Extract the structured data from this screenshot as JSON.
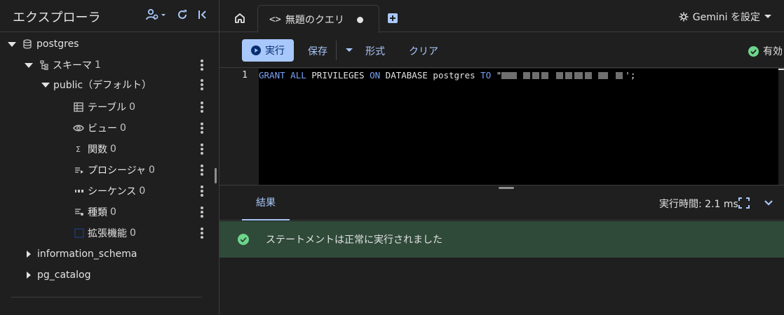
{
  "sidebar": {
    "title": "エクスプローラ",
    "tree": {
      "db": {
        "label": "postgres"
      },
      "schema_group": {
        "label": "スキーマ",
        "count": "1"
      },
      "public": {
        "label": "public（デフォルト）"
      },
      "items": [
        {
          "label": "テーブル",
          "count": "0",
          "icon": "table-icon"
        },
        {
          "label": "ビュー",
          "count": "0",
          "icon": "eye-icon"
        },
        {
          "label": "関数",
          "count": "0",
          "icon": "sigma-icon"
        },
        {
          "label": "プロシージャ",
          "count": "0",
          "icon": "procedure-icon"
        },
        {
          "label": "シーケンス",
          "count": "0",
          "icon": "sequence-icon"
        },
        {
          "label": "種類",
          "count": "0",
          "icon": "type-icon"
        },
        {
          "label": "拡張機能",
          "count": "0",
          "icon": "extension-icon"
        }
      ],
      "other_schemas": [
        {
          "label": "information_schema"
        },
        {
          "label": "pg_catalog"
        }
      ]
    }
  },
  "tabs": {
    "query_tab": {
      "code_glyph": "<>",
      "label": "無題のクエリ"
    }
  },
  "gemini": {
    "label": "Gemini を設定"
  },
  "toolbar": {
    "run_label": "実行",
    "save_label": "保存",
    "format_label": "形式",
    "clear_label": "クリア",
    "status_label": "有効"
  },
  "editor": {
    "line_number": "1",
    "tokens": {
      "t1": "GRANT",
      "t2": "ALL",
      "t3": "PRIVILEGES",
      "t4": "ON",
      "t5": "DATABASE",
      "t6": "postgres",
      "t7": "TO",
      "quote_open": "\"",
      "quote_close": "';"
    }
  },
  "results": {
    "tab_label": "結果",
    "exec_time": "実行時間: 2.1 ms",
    "message": "ステートメントは正常に実行されました"
  },
  "colors": {
    "accent": "#a8c7fa",
    "success_bg": "#2f4a39",
    "success_icon": "#6dd58c"
  }
}
